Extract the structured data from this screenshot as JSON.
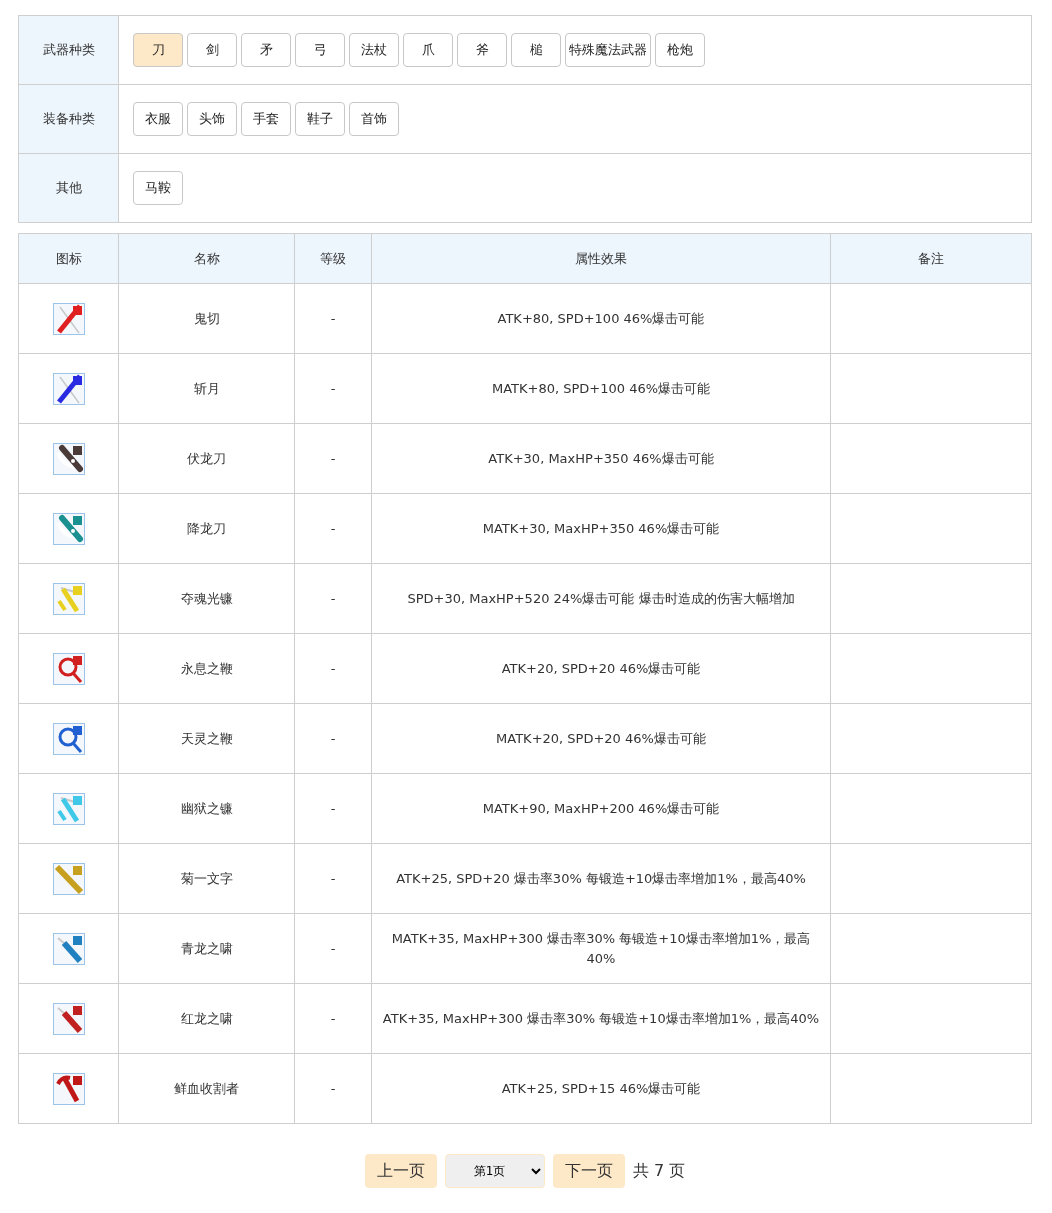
{
  "filters": [
    {
      "label": "武器种类",
      "options": [
        {
          "label": "刀",
          "selected": true
        },
        {
          "label": "剑",
          "selected": false
        },
        {
          "label": "矛",
          "selected": false
        },
        {
          "label": "弓",
          "selected": false
        },
        {
          "label": "法杖",
          "selected": false
        },
        {
          "label": "爪",
          "selected": false
        },
        {
          "label": "斧",
          "selected": false
        },
        {
          "label": "槌",
          "selected": false
        },
        {
          "label": "特殊魔法武器",
          "selected": false
        },
        {
          "label": "枪炮",
          "selected": false
        }
      ]
    },
    {
      "label": "装备种类",
      "options": [
        {
          "label": "衣服",
          "selected": false
        },
        {
          "label": "头饰",
          "selected": false
        },
        {
          "label": "手套",
          "selected": false
        },
        {
          "label": "鞋子",
          "selected": false
        },
        {
          "label": "首饰",
          "selected": false
        }
      ]
    },
    {
      "label": "其他",
      "options": [
        {
          "label": "马鞍",
          "selected": false
        }
      ]
    }
  ],
  "table": {
    "columns": [
      "图标",
      "名称",
      "等级",
      "属性效果",
      "备注"
    ],
    "rows": [
      {
        "icon": {
          "kind": "sword",
          "color": "#e02020"
        },
        "name": "鬼切",
        "level": "-",
        "effect": "ATK+80, SPD+100 46%爆击可能"
      },
      {
        "icon": {
          "kind": "sword",
          "color": "#2a2ae0"
        },
        "name": "斩月",
        "level": "-",
        "effect": "MATK+80, SPD+100 46%爆击可能"
      },
      {
        "icon": {
          "kind": "club",
          "color": "#4a3a38"
        },
        "name": "伏龙刀",
        "level": "-",
        "effect": "ATK+30, MaxHP+350 46%爆击可能"
      },
      {
        "icon": {
          "kind": "club",
          "color": "#1a9090"
        },
        "name": "降龙刀",
        "level": "-",
        "effect": "MATK+30, MaxHP+350 46%爆击可能"
      },
      {
        "icon": {
          "kind": "scythe",
          "color": "#e8d020"
        },
        "name": "夺魂光镰",
        "level": "-",
        "effect": "SPD+30, MaxHP+520 24%爆击可能 爆击时造成的伤害大幅增加"
      },
      {
        "icon": {
          "kind": "whip",
          "color": "#d02020"
        },
        "name": "永息之鞭",
        "level": "-",
        "effect": "ATK+20, SPD+20 46%爆击可能"
      },
      {
        "icon": {
          "kind": "whip",
          "color": "#2060d0"
        },
        "name": "天灵之鞭",
        "level": "-",
        "effect": "MATK+20, SPD+20 46%爆击可能"
      },
      {
        "icon": {
          "kind": "scythe",
          "color": "#40c8e8"
        },
        "name": "幽狱之镰",
        "level": "-",
        "effect": "MATK+90, MaxHP+200 46%爆击可能"
      },
      {
        "icon": {
          "kind": "katana",
          "color": "#c8a020"
        },
        "name": "菊一文字",
        "level": "-",
        "effect": "ATK+25, SPD+20 爆击率30% 每锻造+10爆击率增加1%，最高40%"
      },
      {
        "icon": {
          "kind": "blade",
          "color": "#2080c0"
        },
        "name": "青龙之啸",
        "level": "-",
        "effect": "MATK+35, MaxHP+300 爆击率30% 每锻造+10爆击率增加1%，最高40%"
      },
      {
        "icon": {
          "kind": "blade",
          "color": "#c02020"
        },
        "name": "红龙之啸",
        "level": "-",
        "effect": "ATK+35, MaxHP+300 爆击率30% 每锻造+10爆击率增加1%，最高40%"
      },
      {
        "icon": {
          "kind": "reaper",
          "color": "#c01818"
        },
        "name": "鲜血收割者",
        "level": "-",
        "effect": "ATK+25, SPD+15 46%爆击可能"
      }
    ]
  },
  "pagination": {
    "prev": "上一页",
    "page_select": "第1页",
    "next": "下一页",
    "total": "共 7 页"
  }
}
